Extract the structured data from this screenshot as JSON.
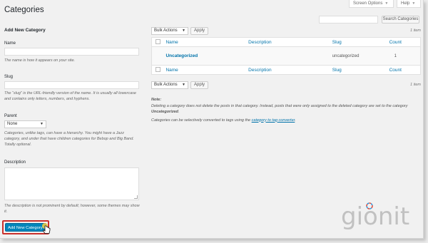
{
  "header": {
    "title": "Categories",
    "screen_options": "Screen Options",
    "help": "Help",
    "search_button": "Search Categories"
  },
  "form": {
    "section_title": "Add New Category",
    "name_label": "Name",
    "name_help": "The name is how it appears on your site.",
    "slug_label": "Slug",
    "slug_help": "The “slug” is the URL-friendly version of the name. It is usually all lowercase and contains only letters, numbers, and hyphens.",
    "parent_label": "Parent",
    "parent_selected": "None",
    "parent_help": "Categories, unlike tags, can have a hierarchy. You might have a Jazz category, and under that have children categories for Bebop and Big Band. Totally optional.",
    "description_label": "Description",
    "description_help": "The description is not prominent by default; however, some themes may show it.",
    "submit_label": "Add New Category"
  },
  "table": {
    "bulk_actions": "Bulk Actions",
    "apply": "Apply",
    "count_text": "1 item",
    "columns": [
      "Name",
      "Description",
      "Slug",
      "Count"
    ],
    "rows": [
      {
        "name": "Uncategorized",
        "description": "",
        "slug": "uncategorized",
        "count": "1"
      }
    ]
  },
  "note": {
    "title": "Note:",
    "line1_a": "Deleting a category does not delete the posts in that category. Instead, posts that were only assigned to the deleted category are set to the category ",
    "line1_b": "Uncategorized",
    "line1_c": ".",
    "line2_a": "Categories can be selectively converted to tags using the ",
    "line2_link": "category to tag converter",
    "line2_b": "."
  },
  "watermark": "gionit",
  "colors": {
    "accent": "#0073aa",
    "primary_button": "#0085ba",
    "highlight_border": "#c9302c"
  }
}
